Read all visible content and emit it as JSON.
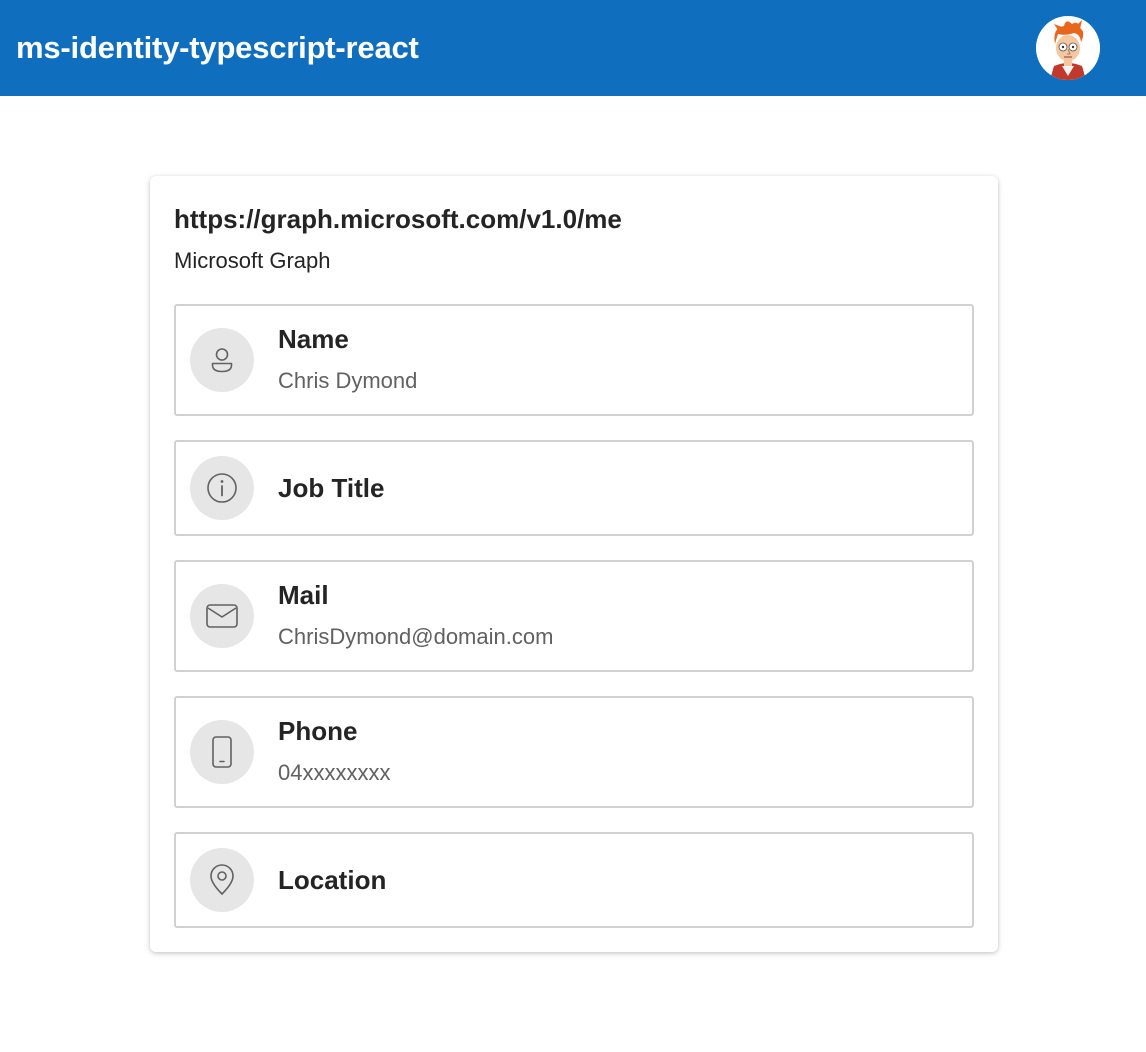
{
  "header": {
    "title": "ms-identity-typescript-react",
    "avatar_icon": "user-avatar-cartoon",
    "background_color": "#106ebe"
  },
  "card": {
    "title": "https://graph.microsoft.com/v1.0/me",
    "subtitle": "Microsoft Graph",
    "items": [
      {
        "icon": "person-icon",
        "label": "Name",
        "value": "Chris Dymond"
      },
      {
        "icon": "info-icon",
        "label": "Job Title",
        "value": ""
      },
      {
        "icon": "mail-icon",
        "label": "Mail",
        "value": "ChrisDymond@domain.com"
      },
      {
        "icon": "phone-icon",
        "label": "Phone",
        "value": "04xxxxxxxx"
      },
      {
        "icon": "location-icon",
        "label": "Location",
        "value": ""
      }
    ]
  }
}
